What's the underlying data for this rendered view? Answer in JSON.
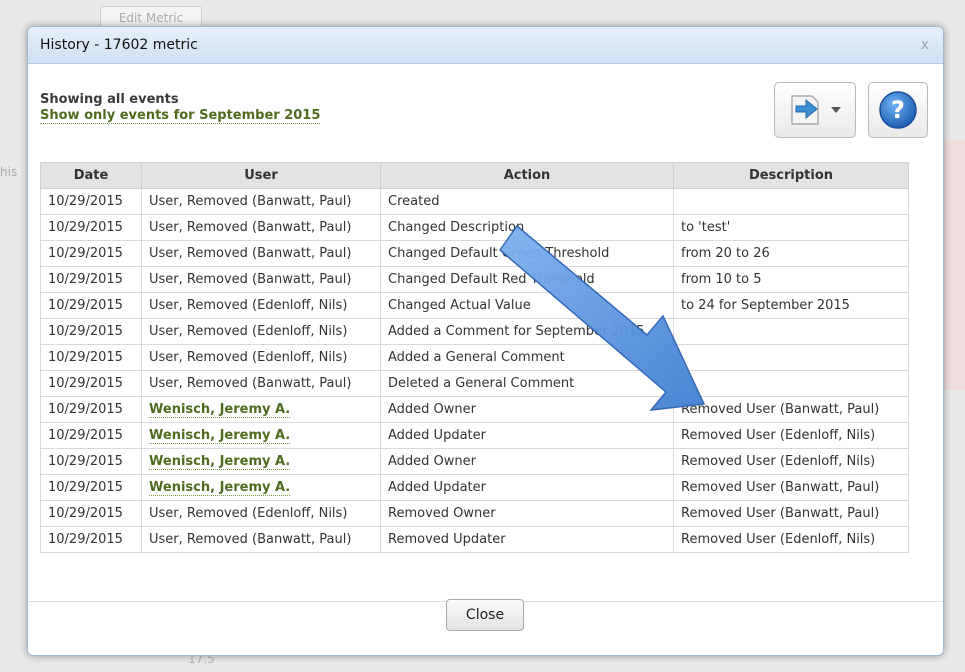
{
  "background": {
    "edit_metric_label": "Edit Metric",
    "side_text": "his",
    "axis_tick": "17.5"
  },
  "dialog": {
    "title": "History - 17602 metric",
    "close_glyph": "x",
    "showing_text": "Showing all events",
    "filter_link": "Show only events for September 2015",
    "export_icon": "export-arrow-icon",
    "help_icon": "help-question-icon",
    "help_glyph": "?",
    "close_button_label": "Close"
  },
  "table": {
    "columns": [
      "Date",
      "User",
      "Action",
      "Description"
    ],
    "rows": [
      {
        "date": "10/29/2015",
        "user": "User, Removed (Banwatt, Paul)",
        "action": "Created",
        "description": ""
      },
      {
        "date": "10/29/2015",
        "user": "User, Removed (Banwatt, Paul)",
        "action": "Changed Description",
        "description": "to 'test'"
      },
      {
        "date": "10/29/2015",
        "user": "User, Removed (Banwatt, Paul)",
        "action": "Changed Default Green Threshold",
        "description": "from 20 to 26"
      },
      {
        "date": "10/29/2015",
        "user": "User, Removed (Banwatt, Paul)",
        "action": "Changed Default Red Threshold",
        "description": "from 10 to 5"
      },
      {
        "date": "10/29/2015",
        "user": "User, Removed (Edenloff, Nils)",
        "action": "Changed Actual Value",
        "description": "to 24 for September 2015"
      },
      {
        "date": "10/29/2015",
        "user": "User, Removed (Edenloff, Nils)",
        "action": "Added a Comment for September 2015",
        "description": ""
      },
      {
        "date": "10/29/2015",
        "user": "User, Removed (Edenloff, Nils)",
        "action": "Added a General Comment",
        "description": ""
      },
      {
        "date": "10/29/2015",
        "user": "User, Removed (Banwatt, Paul)",
        "action": "Deleted a General Comment",
        "description": ""
      },
      {
        "date": "10/29/2015",
        "user": "Wenisch, Jeremy A.",
        "user_link": true,
        "action": "Added Owner",
        "description": "Removed User (Banwatt, Paul)"
      },
      {
        "date": "10/29/2015",
        "user": "Wenisch, Jeremy A.",
        "user_link": true,
        "action": "Added Updater",
        "description": "Removed User (Edenloff, Nils)"
      },
      {
        "date": "10/29/2015",
        "user": "Wenisch, Jeremy A.",
        "user_link": true,
        "action": "Added Owner",
        "description": "Removed User (Edenloff, Nils)"
      },
      {
        "date": "10/29/2015",
        "user": "Wenisch, Jeremy A.",
        "user_link": true,
        "action": "Added Updater",
        "description": "Removed User (Banwatt, Paul)"
      },
      {
        "date": "10/29/2015",
        "user": "User, Removed (Edenloff, Nils)",
        "action": "Removed Owner",
        "description": "Removed User (Banwatt, Paul)"
      },
      {
        "date": "10/29/2015",
        "user": "User, Removed (Banwatt, Paul)",
        "action": "Removed Updater",
        "description": "Removed User (Edenloff, Nils)"
      }
    ]
  },
  "overlay": {
    "arrow_icon": "blue-annotation-arrow",
    "arrow_color": "#4a86d8"
  },
  "colors": {
    "link_green": "#4e6b1f",
    "title_gradient_top": "#e6f0fa",
    "help_blue": "#2a74c9"
  }
}
